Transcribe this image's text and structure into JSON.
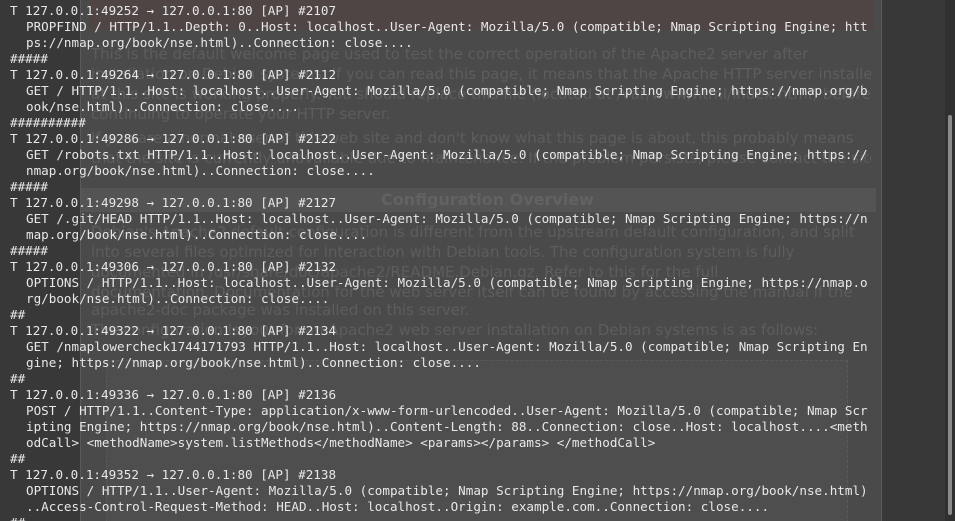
{
  "terminal": {
    "lines": [
      {
        "kind": "header",
        "text": "T 127.0.0.1:49252 -> 127.0.0.1:80 [AP] #2107"
      },
      {
        "kind": "body",
        "text": "PROPFIND / HTTP/1.1..Depth: 0..Host: localhost..User-Agent: Mozilla/5.0 (compatible; Nmap Scripting Engine; htt"
      },
      {
        "kind": "body",
        "text": "ps://nmap.org/book/nse.html)..Connection: close...."
      },
      {
        "kind": "sep",
        "text": "#####"
      },
      {
        "kind": "header",
        "text": "T 127.0.0.1:49264 -> 127.0.0.1:80 [AP] #2112"
      },
      {
        "kind": "body",
        "text": "GET / HTTP/1.1..Host: localhost..User-Agent: Mozilla/5.0 (compatible; Nmap Scripting Engine; https://nmap.org/b"
      },
      {
        "kind": "body",
        "text": "ook/nse.html)..Connection: close...."
      },
      {
        "kind": "sep",
        "text": "##########"
      },
      {
        "kind": "header",
        "text": "T 127.0.0.1:49286 -> 127.0.0.1:80 [AP] #2122"
      },
      {
        "kind": "body",
        "text": "GET /robots.txt HTTP/1.1..Host: localhost..User-Agent: Mozilla/5.0 (compatible; Nmap Scripting Engine; https://"
      },
      {
        "kind": "body",
        "text": "nmap.org/book/nse.html)..Connection: close...."
      },
      {
        "kind": "sep",
        "text": "#####"
      },
      {
        "kind": "header",
        "text": "T 127.0.0.1:49298 -> 127.0.0.1:80 [AP] #2127"
      },
      {
        "kind": "body",
        "text": "GET /.git/HEAD HTTP/1.1..Host: localhost..User-Agent: Mozilla/5.0 (compatible; Nmap Scripting Engine; https://n"
      },
      {
        "kind": "body",
        "text": "map.org/book/nse.html)..Connection: close...."
      },
      {
        "kind": "sep",
        "text": "#####"
      },
      {
        "kind": "header",
        "text": "T 127.0.0.1:49306 -> 127.0.0.1:80 [AP] #2132"
      },
      {
        "kind": "body",
        "text": "OPTIONS / HTTP/1.1..Host: localhost..User-Agent: Mozilla/5.0 (compatible; Nmap Scripting Engine; https://nmap.o"
      },
      {
        "kind": "body",
        "text": "rg/book/nse.html)..Connection: close...."
      },
      {
        "kind": "sep",
        "text": "##"
      },
      {
        "kind": "header",
        "text": "T 127.0.0.1:49322 -> 127.0.0.1:80 [AP] #2134"
      },
      {
        "kind": "body",
        "text": "GET /nmaplowercheck1744171793 HTTP/1.1..Host: localhost..User-Agent: Mozilla/5.0 (compatible; Nmap Scripting En"
      },
      {
        "kind": "body",
        "text": "gine; https://nmap.org/book/nse.html)..Connection: close...."
      },
      {
        "kind": "sep",
        "text": "##"
      },
      {
        "kind": "header",
        "text": "T 127.0.0.1:49336 -> 127.0.0.1:80 [AP] #2136"
      },
      {
        "kind": "body",
        "text": "POST / HTTP/1.1..Content-Type: application/x-www-form-urlencoded..User-Agent: Mozilla/5.0 (compatible; Nmap Scr"
      },
      {
        "kind": "body",
        "text": "ipting Engine; https://nmap.org/book/nse.html)..Content-Length: 88..Connection: close..Host: localhost....<meth"
      },
      {
        "kind": "body",
        "text": "odCall> <methodName>system.listMethods</methodName> <params></params> </methodCall>"
      },
      {
        "kind": "sep",
        "text": "##"
      },
      {
        "kind": "header",
        "text": "T 127.0.0.1:49352 -> 127.0.0.1:80 [AP] #2138"
      },
      {
        "kind": "body",
        "text": "OPTIONS / HTTP/1.1..User-Agent: Mozilla/5.0 (compatible; Nmap Scripting Engine; https://nmap.org/book/nse.html)"
      },
      {
        "kind": "body",
        "text": "..Access-Control-Request-Method: HEAD..Host: localhost..Origin: example.com..Connection: close...."
      },
      {
        "kind": "sep",
        "text": "##"
      }
    ]
  },
  "background_page": {
    "paragraphs": [
      "This is the default welcome page used to test the correct operation of the Apache2 server after",
      "installation on Debian systems. If you can read this page, it means that the Apache HTTP server installed",
      "at this site is working properly. You should replace this file (located at /var/www/html/index.html) before",
      "continuing to operate your HTTP server.",
      "If you are a normal user of this web site and don't know what this page is about, this probably means",
      "that the site is currently unavailable due to maintenance. If the problem persists, please contact the site's administrator."
    ],
    "section_title": "Configuration Overview",
    "config_paragraphs": [
      "Debian's Apache2 default configuration is different from the upstream default configuration, and split",
      "into several files optimized for interaction with Debian tools. The configuration system is fully",
      "documented in /usr/share/doc/apache2/README.Debian.gz. Refer to this for the full",
      "documentation. Documentation for the web server itself can be found by accessing the manual if the",
      "apache2-doc package was installed on this server.",
      "The configuration layout for an Apache2 web server installation on Debian systems is as follows:"
    ]
  },
  "scrollbar": {
    "position_fraction": 0.95
  }
}
